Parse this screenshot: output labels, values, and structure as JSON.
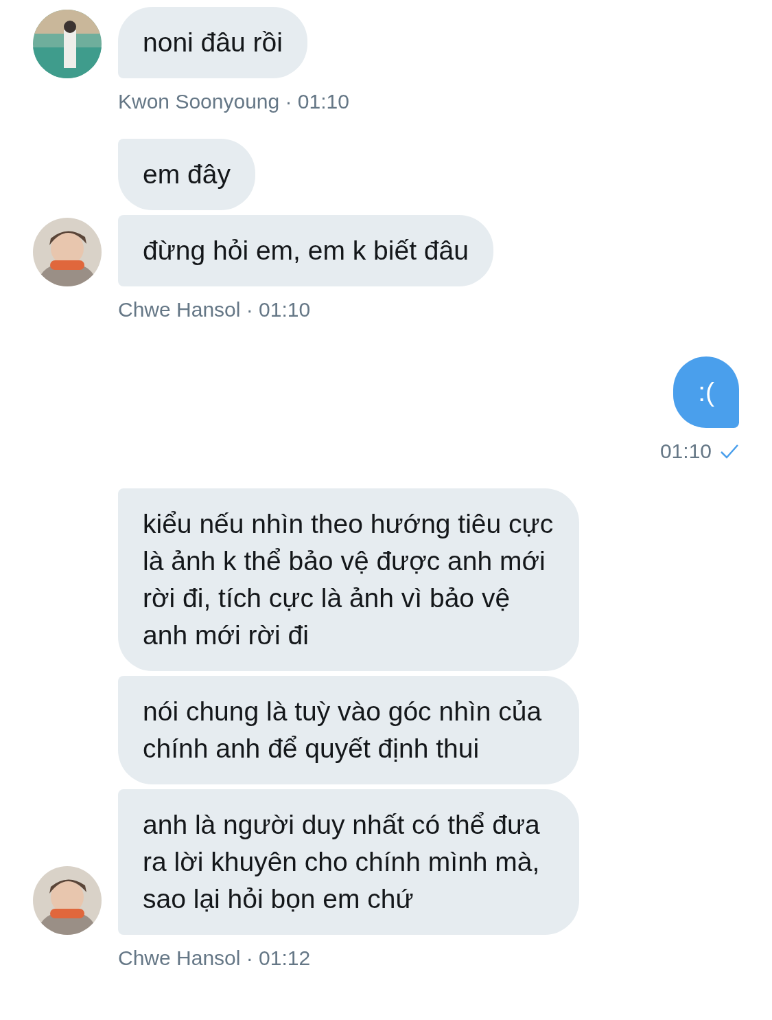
{
  "messages": [
    {
      "kind": "received",
      "avatar": {
        "kind": "picture"
      },
      "bubbles": [
        "noni đâu rồi"
      ],
      "meta": "Kwon Soonyoung · 01:10"
    },
    {
      "kind": "received",
      "avatar": {
        "kind": "picture"
      },
      "bubbles": [
        "em đây",
        "đừng hỏi em, em k biết đâu"
      ],
      "meta": "Chwe Hansol · 01:10"
    },
    {
      "kind": "sent",
      "bubbles": [
        ":("
      ],
      "meta": "01:10",
      "read": true
    },
    {
      "kind": "received",
      "avatar": {
        "kind": "picture"
      },
      "bubbles": [
        "kiểu nếu nhìn theo hướng tiêu cực là ảnh k thể bảo vệ được anh mới rời đi, tích cực là ảnh vì bảo vệ anh mới rời đi",
        "nói chung là tuỳ vào góc nhìn của chính anh để quyết định thui",
        "anh là người duy nhất có thể đưa ra lời khuyên cho chính mình mà, sao lại hỏi bọn em chứ"
      ],
      "meta": "Chwe Hansol · 01:12"
    }
  ]
}
